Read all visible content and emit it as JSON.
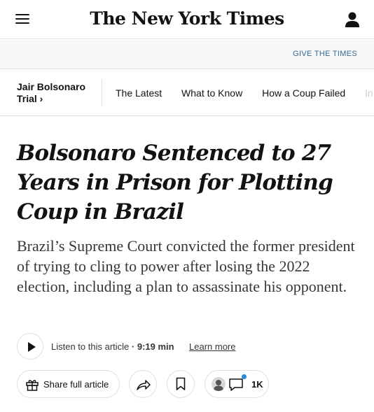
{
  "header": {
    "logo_text": "The New York Times",
    "menu_icon": "hamburger-menu-icon",
    "account_icon": "user-icon"
  },
  "give_bar": {
    "label": "GIVE THE TIMES"
  },
  "section_nav": {
    "title_line1": "Jair Bolsonaro",
    "title_line2": "Trial ›",
    "links": [
      "The Latest",
      "What to Know",
      "How a Coup Failed",
      "In"
    ]
  },
  "article": {
    "headline": "Bolsonaro Sentenced to 27 Years in Prison for Plotting Coup in Brazil",
    "summary": "Brazil’s Supreme Court convicted the former president of trying to cling to power after losing the 2022 election, including a plan to assassinate his opponent."
  },
  "audio": {
    "label": "Listen to this article",
    "duration": "· 9:19 min",
    "learn_more": "Learn more"
  },
  "actions": {
    "share_full_label": "Share full article",
    "comment_count": "1K"
  },
  "colors": {
    "link_blue": "#326891",
    "notification_dot": "#2b8ad8",
    "divider": "#dfdfdf"
  }
}
